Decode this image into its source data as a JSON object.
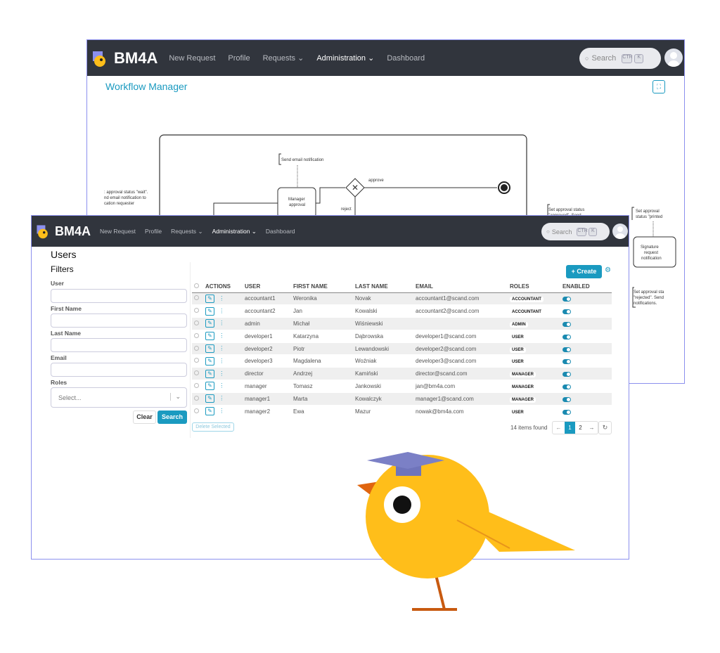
{
  "app": {
    "brand": "BM4A",
    "nav": [
      "New Request",
      "Profile",
      "Requests",
      "Administration",
      "Dashboard"
    ],
    "active_nav": "Administration",
    "search_placeholder": "Search",
    "kbd": [
      "CTR",
      "K"
    ]
  },
  "workflow": {
    "title": "Workflow Manager",
    "notes": {
      "send_email": "Send email notification",
      "approve": "approve",
      "reject": "reject",
      "task": "Manager approval",
      "left_note": ": approval status \"wait\". nd email notification to cation requester",
      "approved_note": "Set approval status \"approved\". Send",
      "printed_note": "Set approval status \"printed",
      "signature": "Signature request notification",
      "rejected_note": "Set approval sta \"rejected\". Send notifications."
    }
  },
  "users": {
    "title": "Users",
    "filters": {
      "title": "Filters",
      "fields": [
        "User",
        "First Name",
        "Last Name",
        "Email",
        "Roles"
      ],
      "roles_placeholder": "Select...",
      "clear": "Clear",
      "search": "Search"
    },
    "create": "+ Create",
    "delete_selected": "Delete Selected",
    "items_found": "14 items found",
    "pages": [
      "1",
      "2"
    ],
    "current_page": "1",
    "columns": [
      "ACTIONS",
      "USER",
      "FIRST NAME",
      "LAST NAME",
      "EMAIL",
      "ROLES",
      "ENABLED"
    ],
    "rows": [
      {
        "user": "accountant1",
        "first": "Weronika",
        "last": "Novak",
        "email": "accountant1@scand.com",
        "role": "ACCOUNTANT",
        "enabled": true
      },
      {
        "user": "accountant2",
        "first": "Jan",
        "last": "Kowalski",
        "email": "accountant2@scand.com",
        "role": "ACCOUNTANT",
        "enabled": true
      },
      {
        "user": "admin",
        "first": "Michał",
        "last": "Wiśniewski",
        "email": "",
        "role": "ADMIN",
        "enabled": true
      },
      {
        "user": "developer1",
        "first": "Katarzyna",
        "last": "Dąbrowska",
        "email": "developer1@scand.com",
        "role": "USER",
        "enabled": true
      },
      {
        "user": "developer2",
        "first": "Piotr",
        "last": "Lewandowski",
        "email": "developer2@scand.com",
        "role": "USER",
        "enabled": true
      },
      {
        "user": "developer3",
        "first": "Magdalena",
        "last": "Woźniak",
        "email": "developer3@scand.com",
        "role": "USER",
        "enabled": true
      },
      {
        "user": "director",
        "first": "Andrzej",
        "last": "Kamiński",
        "email": "director@scand.com",
        "role": "MANAGER",
        "enabled": true
      },
      {
        "user": "manager",
        "first": "Tomasz",
        "last": "Jankowski",
        "email": "jan@bm4a.com",
        "role": "MANAGER",
        "enabled": true
      },
      {
        "user": "manager1",
        "first": "Marta",
        "last": "Kowalczyk",
        "email": "manager1@scand.com",
        "role": "MANAGER",
        "enabled": true
      },
      {
        "user": "manager2",
        "first": "Ewa",
        "last": "Mazur",
        "email": "nowak@bm4a.com",
        "role": "USER",
        "enabled": true
      }
    ]
  },
  "colors": {
    "accent": "#1a9ac0",
    "header": "#31353d",
    "frame": "#8c90ee",
    "bird": "#ffbe1a",
    "hat": "#7b80c6"
  }
}
